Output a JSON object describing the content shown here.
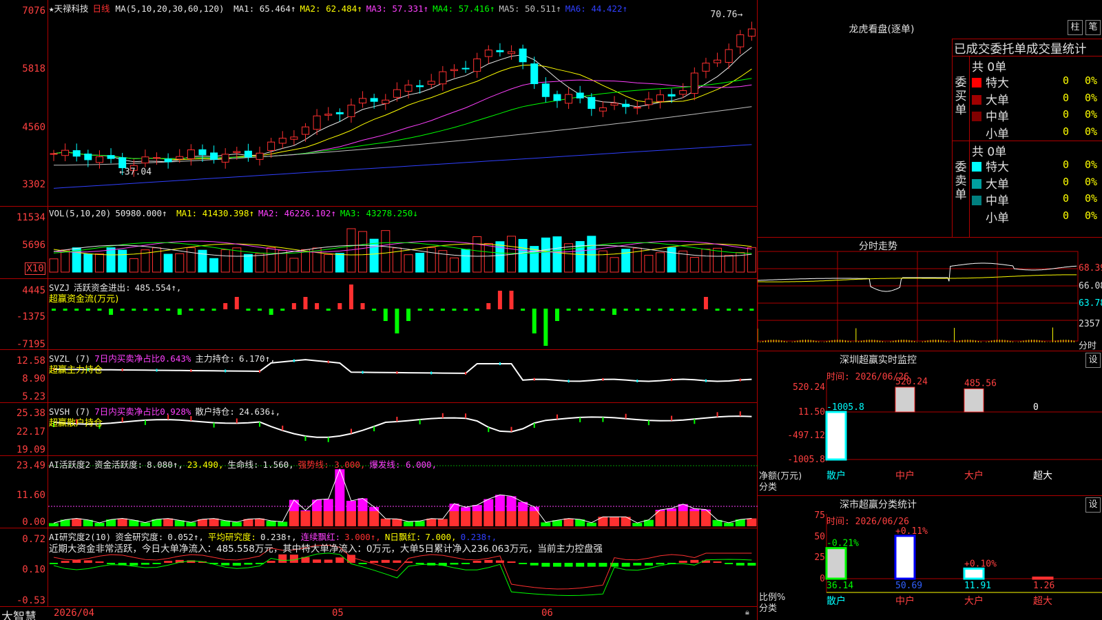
{
  "app": {
    "brand": "大智慧"
  },
  "main": {
    "stock_name": "★天禄科技",
    "period": "日线",
    "ma_def": "MA(5,10,20,30,60,120)",
    "ma": [
      {
        "label": "MA1:",
        "value": "65.464↑",
        "color": "#e8e8e8"
      },
      {
        "label": "MA2:",
        "value": "62.484↑",
        "color": "#ffff00"
      },
      {
        "label": "MA3:",
        "value": "57.331↑",
        "color": "#ff40ff"
      },
      {
        "label": "MA4:",
        "value": "57.416↑",
        "color": "#00ff00"
      },
      {
        "label": "MA5:",
        "value": "50.511↑",
        "color": "#c0c0c0"
      },
      {
        "label": "MA6:",
        "value": "44.422↑",
        "color": "#3040ff"
      }
    ],
    "y_labels": [
      "7076",
      "5818",
      "4560",
      "3302"
    ],
    "high_label": "70.76",
    "low_label": "37.04"
  },
  "vol": {
    "def": "VOL(5,10,20)",
    "value": "50980.000↑",
    "ma": [
      {
        "label": "MA1:",
        "value": "41430.398↑",
        "color": "#ffff00"
      },
      {
        "label": "MA2:",
        "value": "46226.102↑",
        "color": "#ff40ff"
      },
      {
        "label": "MA3:",
        "value": "43278.250↓",
        "color": "#00ff00"
      }
    ],
    "y_labels": [
      "11534",
      "5696"
    ],
    "unit": "X10"
  },
  "svzj": {
    "def": "SVZJ",
    "label": "活跃资金进出:",
    "value": "485.554↑,",
    "sub": "超赢资金流(万元)",
    "y_labels": [
      "4445",
      "-1375",
      "-7195"
    ]
  },
  "svzl": {
    "def": "SVZL (7)",
    "label1": "7日内买卖净占比0.643%",
    "label2": "主力持仓:",
    "value": "6.170↑,",
    "sub": "超赢主力持仓",
    "y_labels": [
      "12.58",
      "8.90",
      "5.23"
    ]
  },
  "svsh": {
    "def": "SVSH (7)",
    "label1": "7日内买卖净占比0.928%",
    "label2": "散户持仓:",
    "value": "24.636↓,",
    "sub": "超赢散户持仓",
    "y_labels": [
      "25.38",
      "22.17",
      "19.09"
    ]
  },
  "ai_active": {
    "def": "AI活跃度2",
    "label": "资金活跃度:",
    "v1": "8.080↑,",
    "v2": "23.490,",
    "life_label": "生命线:",
    "life": "1.560,",
    "strong": "强势线: 3.000,",
    "burst": "爆发线: 6.000,",
    "y_labels": [
      "23.49",
      "11.60",
      "0.00"
    ]
  },
  "ai_research": {
    "def": "AI研究度2(10)",
    "label": "资金研究度:",
    "v1": "0.052↑,",
    "avg_label": "平均研究度:",
    "avg": "0.238↑,",
    "streak_label": "连续飘红:",
    "streak": "3.000↑,",
    "nday_label": "N日飘红:",
    "nday": "7.000,",
    "v5": "0.238↑,",
    "comment": "近期大资金非常活跃，今日大单净流入：485.558万元，其中特大单净流入：0万元，大单5日累计净入236.063万元，当前主力控盘强",
    "y_labels": [
      "0.72",
      "0.10",
      "-0.53"
    ]
  },
  "xaxis": [
    "2026/04",
    "05",
    "06"
  ],
  "lhb": {
    "title": "龙虎看盘(逐单)",
    "btn1": "柱",
    "btn2": "笔",
    "header": "已成交委托单成交量统计",
    "buy_side": "委买单",
    "sell_side": "委卖单",
    "buy_total": "共 0单",
    "sell_total": "共 0单",
    "buy_rows": [
      {
        "name": "特大",
        "count": "0",
        "pct": "0%",
        "color": "#ff0000"
      },
      {
        "name": "大单",
        "count": "0",
        "pct": "0%",
        "color": "#a00000"
      },
      {
        "name": "中单",
        "count": "0",
        "pct": "0%",
        "color": "#800000"
      },
      {
        "name": "小单",
        "count": "0",
        "pct": "0%",
        "color": "#000000"
      }
    ],
    "sell_rows": [
      {
        "name": "特大",
        "count": "0",
        "pct": "0%",
        "color": "#00ffff"
      },
      {
        "name": "大单",
        "count": "0",
        "pct": "0%",
        "color": "#00a0a0"
      },
      {
        "name": "中单",
        "count": "0",
        "pct": "0%",
        "color": "#008080"
      },
      {
        "name": "小单",
        "count": "0",
        "pct": "0%",
        "color": "#000000"
      }
    ]
  },
  "intraday": {
    "title": "分时走势",
    "price_labels": [
      "68.39",
      "66.08",
      "63.78"
    ],
    "vol_label": "2357",
    "footer": "分时"
  },
  "sz_monitor": {
    "title": "深圳超赢实时监控",
    "btn": "设",
    "time": "时间: 2026/06/26",
    "y_labels": [
      "520.24",
      "11.50",
      "-497.12",
      "-1005.8"
    ],
    "axis_left": "净额(万元)",
    "axis_left2": "分类",
    "bars": [
      {
        "cat": "散户",
        "value": -1005.8,
        "label": "-1005.8"
      },
      {
        "cat": "中户",
        "value": 520.24,
        "label": "520.24"
      },
      {
        "cat": "大户",
        "value": 485.56,
        "label": "485.56"
      },
      {
        "cat": "超大",
        "value": 0,
        "label": "0"
      }
    ]
  },
  "sz_class": {
    "title": "深市超赢分类统计",
    "btn": "设",
    "time": "时间: 2026/06/26",
    "y_labels": [
      "75",
      "50",
      "25",
      "0"
    ],
    "axis_left": "比例%",
    "axis_left2": "分类",
    "bars": [
      {
        "cat": "散户",
        "value": 36.14,
        "label": "36.14",
        "change": "-0.21%"
      },
      {
        "cat": "中户",
        "value": 50.69,
        "label": "50.69",
        "change": "+0.11%"
      },
      {
        "cat": "大户",
        "value": 11.91,
        "label": "11.91",
        "change": "+0.10%"
      },
      {
        "cat": "超大",
        "value": 1.26,
        "label": "1.26",
        "change": ""
      }
    ]
  }
}
